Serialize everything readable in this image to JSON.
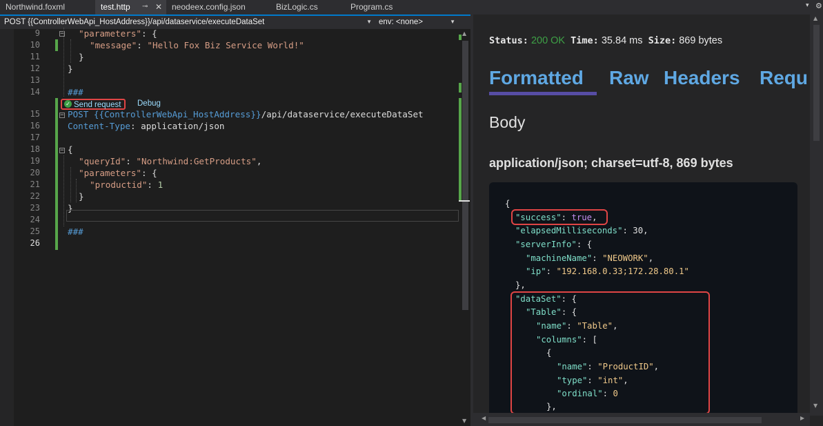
{
  "tabs": [
    {
      "label": "Northwind.foxml",
      "active": false
    },
    {
      "label": "test.http",
      "active": true
    },
    {
      "label": "neodeex.config.json",
      "active": false
    },
    {
      "label": "BizLogic.cs",
      "active": false
    },
    {
      "label": "Program.cs",
      "active": false
    }
  ],
  "tab_icons": {
    "pin": "pin-icon",
    "close": "close-icon"
  },
  "navbar": {
    "request_combo": "POST {{ControllerWebApi_HostAddress}}/api/dataservice/executeDataSet",
    "env_combo": "env: <none>"
  },
  "editor": {
    "line_numbers": [
      "9",
      "10",
      "11",
      "12",
      "13",
      "14",
      "15",
      "16",
      "17",
      "18",
      "19",
      "20",
      "21",
      "22",
      "23",
      "24",
      "25",
      "26"
    ],
    "lines": {
      "l9_key": "\"parameters\"",
      "l9_rest": ": {",
      "l10_key": "\"message\"",
      "l10_sep": ": ",
      "l10_val": "\"Hello Fox Biz Service World!\"",
      "l11": "}",
      "l12": "}",
      "l14": "###",
      "l15_method": "POST",
      "l15_var": " {{ControllerWebApi_HostAddress}}",
      "l15_path": "/api/dataservice/executeDataSet",
      "l16_hdr": "Content-Type",
      "l16_val": ": application/json",
      "l18": "{",
      "l19_key": "\"queryId\"",
      "l19_sep": ": ",
      "l19_val": "\"Northwind:GetProducts\"",
      "l19_end": ",",
      "l20_key": "\"parameters\"",
      "l20_rest": ": {",
      "l21_key": "\"productid\"",
      "l21_sep": ": ",
      "l21_val": "1",
      "l22": "}",
      "l23": "}",
      "l25": "###"
    },
    "codelens": {
      "send": "Send request",
      "debug": "Debug"
    }
  },
  "response": {
    "status_label": "Status:",
    "status_value": "200 OK",
    "time_label": "Time:",
    "time_value": "35.84 ms",
    "size_label": "Size:",
    "size_value": "869 bytes",
    "tabs": [
      "Formatted",
      "Raw",
      "Headers",
      "Requ"
    ],
    "active_tab": "Formatted",
    "body_heading": "Body",
    "content_type": "application/json; charset=utf-8, 869 bytes",
    "json": {
      "open": "{",
      "success_key": "\"success\"",
      "success_val": "true",
      "elapsed_key": "\"elapsedMilliseconds\"",
      "elapsed_val": "30",
      "server_key": "\"serverInfo\"",
      "machine_key": "\"machineName\"",
      "machine_val": "\"NEOWORK\"",
      "ip_key": "\"ip\"",
      "ip_val": "\"192.168.0.33;172.28.80.1\"",
      "close_obj": "},",
      "dataset_key": "\"dataSet\"",
      "table_key": "\"Table\"",
      "name_key": "\"name\"",
      "table_name_val": "\"Table\"",
      "columns_key": "\"columns\"",
      "arr_open": "[",
      "obj_open": "{",
      "col_name_val": "\"ProductID\"",
      "type_key": "\"type\"",
      "type_val": "\"int\"",
      "ordinal_key": "\"ordinal\"",
      "ordinal_val": "0",
      "obj_close": "},"
    }
  },
  "colors": {
    "accent": "#007acc",
    "status_ok": "#3ea046",
    "highlight_box": "#e04545",
    "tab_link": "#5fa8e3",
    "tab_underline": "#574da5"
  }
}
